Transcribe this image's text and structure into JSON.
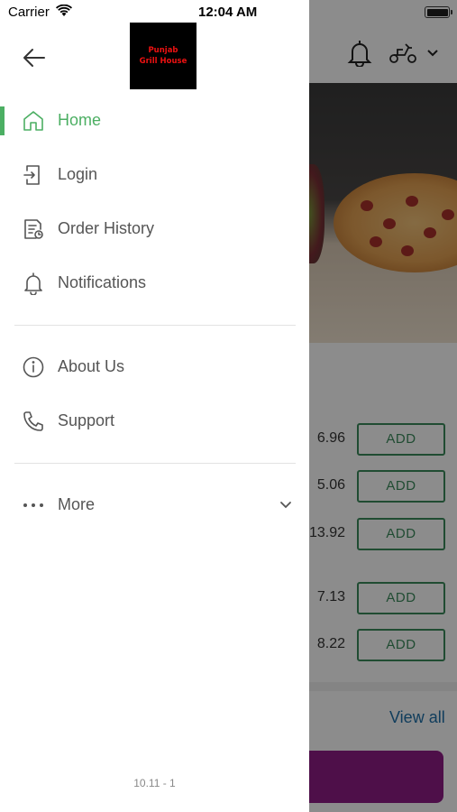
{
  "status_bar": {
    "carrier": "Carrier",
    "time": "12:04 AM"
  },
  "drawer": {
    "logo_line1": "Punjab",
    "logo_line2": "Grill House",
    "menu": [
      {
        "label": "Home",
        "icon": "home-icon",
        "active": true
      },
      {
        "label": "Login",
        "icon": "login-icon",
        "active": false
      },
      {
        "label": "Order History",
        "icon": "order-history-icon",
        "active": false
      },
      {
        "label": "Notifications",
        "icon": "bell-icon",
        "active": false
      },
      {
        "label": "About Us",
        "icon": "info-icon",
        "active": false
      },
      {
        "label": "Support",
        "icon": "phone-icon",
        "active": false
      },
      {
        "label": "More",
        "icon": "more-dots-icon",
        "active": false
      }
    ],
    "version": "10.11 - 1"
  },
  "background": {
    "items": [
      {
        "price": "6.96",
        "button": "ADD"
      },
      {
        "price": "5.06",
        "button": "ADD"
      },
      {
        "price": "13.92",
        "button": "ADD"
      },
      {
        "price": "7.13",
        "button": "ADD"
      },
      {
        "price": "8.22",
        "button": "ADD"
      }
    ],
    "view_all": "View all"
  },
  "colors": {
    "accent": "#4caf63",
    "add_button": "#3b8a5c",
    "cta": "#8e1c86",
    "link": "#1e6fa8"
  }
}
